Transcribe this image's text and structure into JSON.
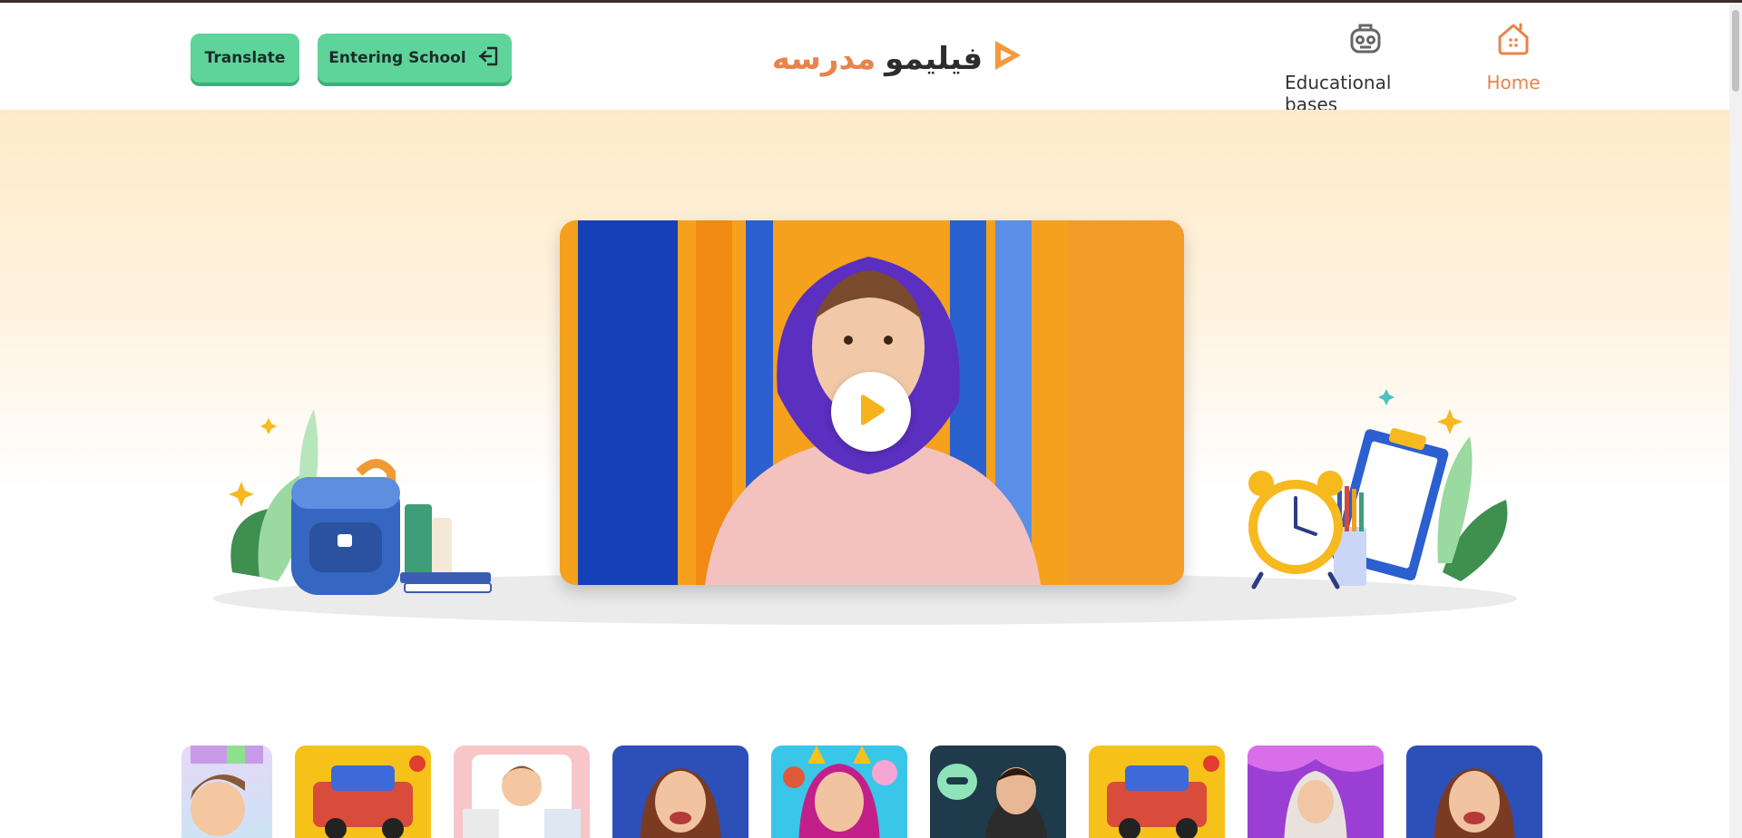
{
  "header": {
    "translate_label": "Translate",
    "school_label": "Entering School",
    "logo_text_1": "مدرسه",
    "logo_text_2": "فیلیمو",
    "nav": {
      "educational_bases": "Educational bases",
      "home": "Home"
    }
  },
  "hero": {
    "video": "intro video (girl in purple hijab)"
  },
  "thumbnails": [
    {
      "name": "boy-cartoon-thumb"
    },
    {
      "name": "toy-car-thumb"
    },
    {
      "name": "girl-drawing-thumb"
    },
    {
      "name": "woman-science-thumb"
    },
    {
      "name": "girl-cat-ears-thumb"
    },
    {
      "name": "man-robot-thumb"
    },
    {
      "name": "toy-car-thumb-2"
    },
    {
      "name": "woman-slime-thumb"
    },
    {
      "name": "woman-science-thumb-2"
    }
  ],
  "colors": {
    "accent": "#e8834b",
    "button": "#5ed49a",
    "hero_top": "#fdebc8"
  }
}
